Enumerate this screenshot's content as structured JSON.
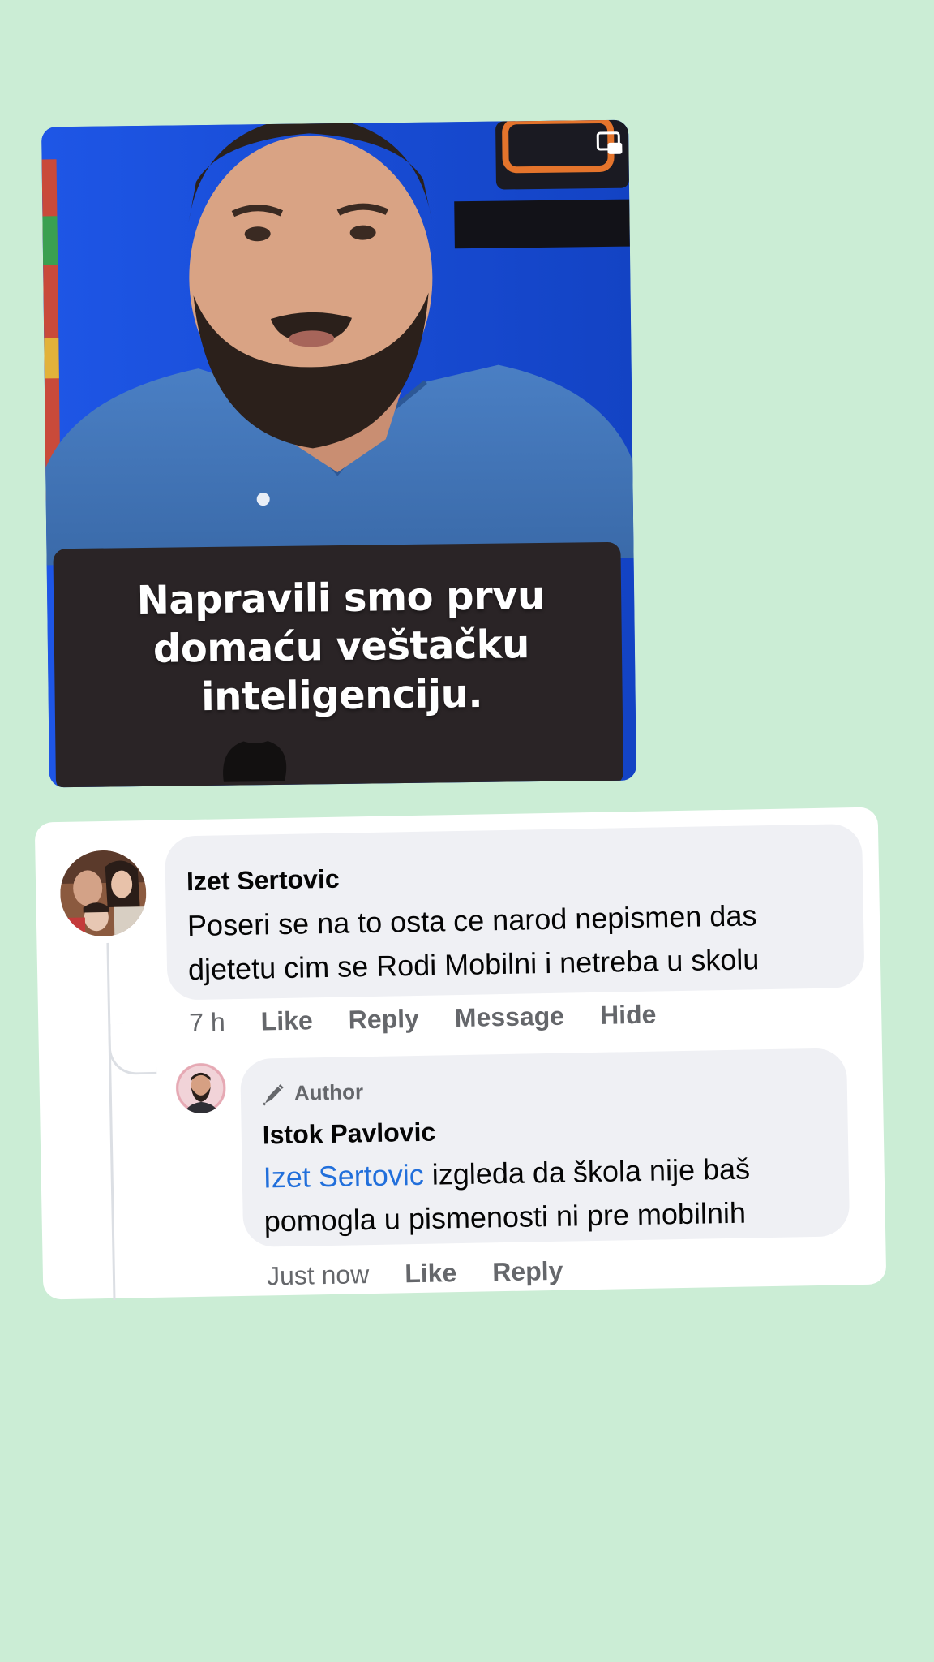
{
  "video": {
    "caption": "Napravili smo prvu domaću veštačku inteligenciju.",
    "icons": [
      "picture-in-picture-icon"
    ]
  },
  "comment": {
    "author": "Izet Sertovic",
    "text": "Poseri se na to osta ce narod nepismen das djetetu cim se Rodi Mobilni i netreba u skolu",
    "time": "7 h",
    "actions": {
      "like": "Like",
      "reply": "Reply",
      "message": "Message",
      "hide": "Hide"
    }
  },
  "reply": {
    "badge": "Author",
    "author": "Istok Pavlovic",
    "mention": "Izet Sertovic",
    "text": "izgleda da škola nije baš pomogla u pismenosti ni pre mobilnih",
    "time": "Just now",
    "actions": {
      "like": "Like",
      "reply": "Reply"
    }
  },
  "colors": {
    "background": "#cbedd5",
    "bubble": "#eff0f4",
    "mention": "#216fdb",
    "meta_text": "#65676b"
  }
}
